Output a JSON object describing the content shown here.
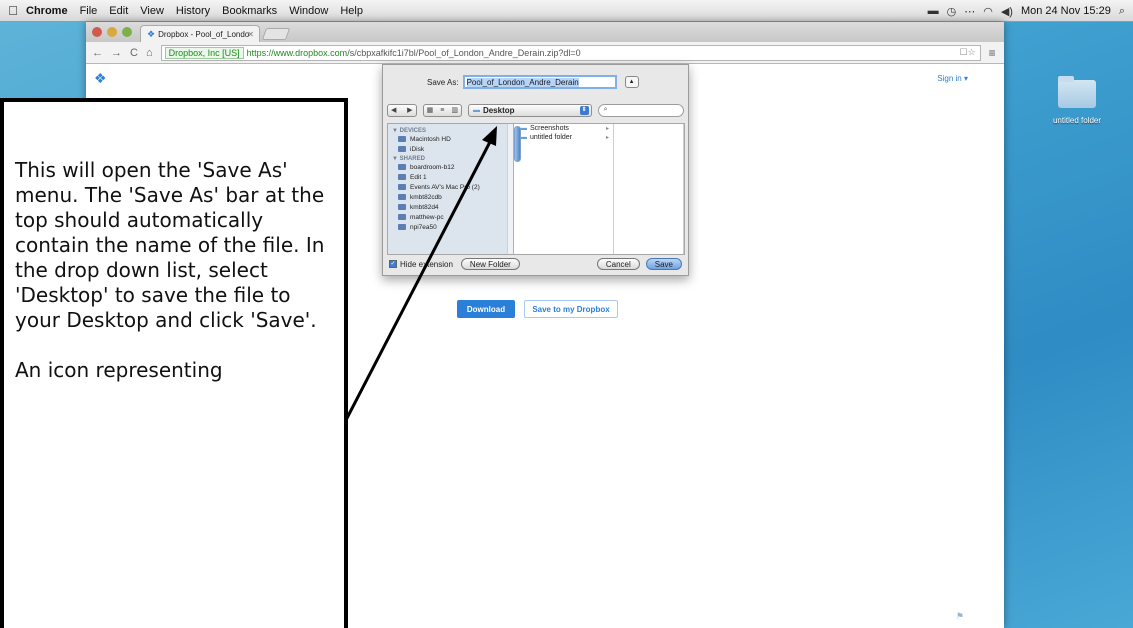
{
  "menubar": {
    "apple_icon": "apple-icon",
    "app": "Chrome",
    "items": [
      "File",
      "Edit",
      "View",
      "History",
      "Bookmarks",
      "Window",
      "Help"
    ],
    "clock": "Mon 24 Nov 15:29"
  },
  "browser": {
    "tab_title": "Dropbox - Pool_of_Londo",
    "ssl_label": "Dropbox, Inc [US]",
    "url_host": "https://www.dropbox.com",
    "url_path": "/s/cbpxafkifc1i7bl/Pool_of_London_Andre_Derain.zip?dl=0"
  },
  "page": {
    "sign_in": "Sign in ▾",
    "download_button": "Download",
    "save_to_dropbox_button": "Save to my Dropbox"
  },
  "dialog": {
    "save_as_label": "Save As:",
    "save_as_value": "Pool_of_London_Andre_Derain",
    "location": "Desktop",
    "sidebar": {
      "devices_header": "▼ DEVICES",
      "devices": [
        "Macintosh HD",
        "iDisk"
      ],
      "shared_header": "▼ SHARED",
      "shared": [
        "boardroom-b12",
        "Edit 1",
        "Events AV's Mac Pro (2)",
        "kmbt82cdb",
        "kmbt82d4",
        "matthew-pc",
        "npi7ea50"
      ]
    },
    "files": [
      "Screenshots",
      "untitled folder"
    ],
    "hide_extension": "Hide extension",
    "new_folder": "New Folder",
    "cancel": "Cancel",
    "save": "Save"
  },
  "desktop": {
    "folder_label": "untitled folder"
  },
  "note": {
    "paragraph1": "This will open the 'Save As' menu. The 'Save As' bar at the top should automatically contain the name of the file. In the drop down list, select 'Desktop' to save the file to your Desktop and click 'Save'.",
    "paragraph2": "An icon representing"
  },
  "colors": {
    "dropbox_blue": "#2a7fd9",
    "desktop_blue": "#3f9fcf"
  }
}
